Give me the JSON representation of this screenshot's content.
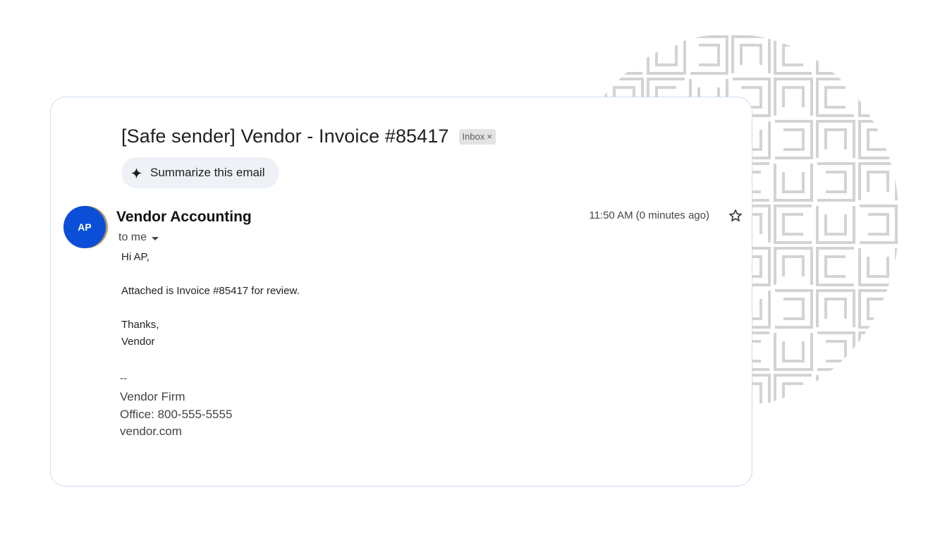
{
  "email": {
    "subject": "[Safe sender] Vendor - Invoice #85417",
    "label_chip": "Inbox",
    "label_chip_close": "×",
    "summarize_label": "Summarize this email",
    "sender": {
      "initials": "AP",
      "name": "Vendor Accounting",
      "recipient": "to me"
    },
    "timestamp": "11:50 AM (0 minutes ago)",
    "body": {
      "greeting": "Hi AP,",
      "line1": "Attached is Invoice #85417 for review.",
      "closing": "Thanks,",
      "sign_name": "Vendor"
    },
    "signature": {
      "separator": "--",
      "firm": "Vendor Firm",
      "office": "Office: 800-555-5555",
      "website": "vendor.com"
    }
  },
  "icons": {
    "summarize": "sparkle-icon",
    "recipient_details": "chevron-down-icon",
    "star": "star-icon"
  },
  "colors": {
    "avatar_bg": "#0b4fd8",
    "card_border": "#cfdcf0",
    "summarize_bg": "#eef1f6",
    "chip_bg": "#e3e3e3",
    "pattern_stroke": "#d3d3d3"
  }
}
